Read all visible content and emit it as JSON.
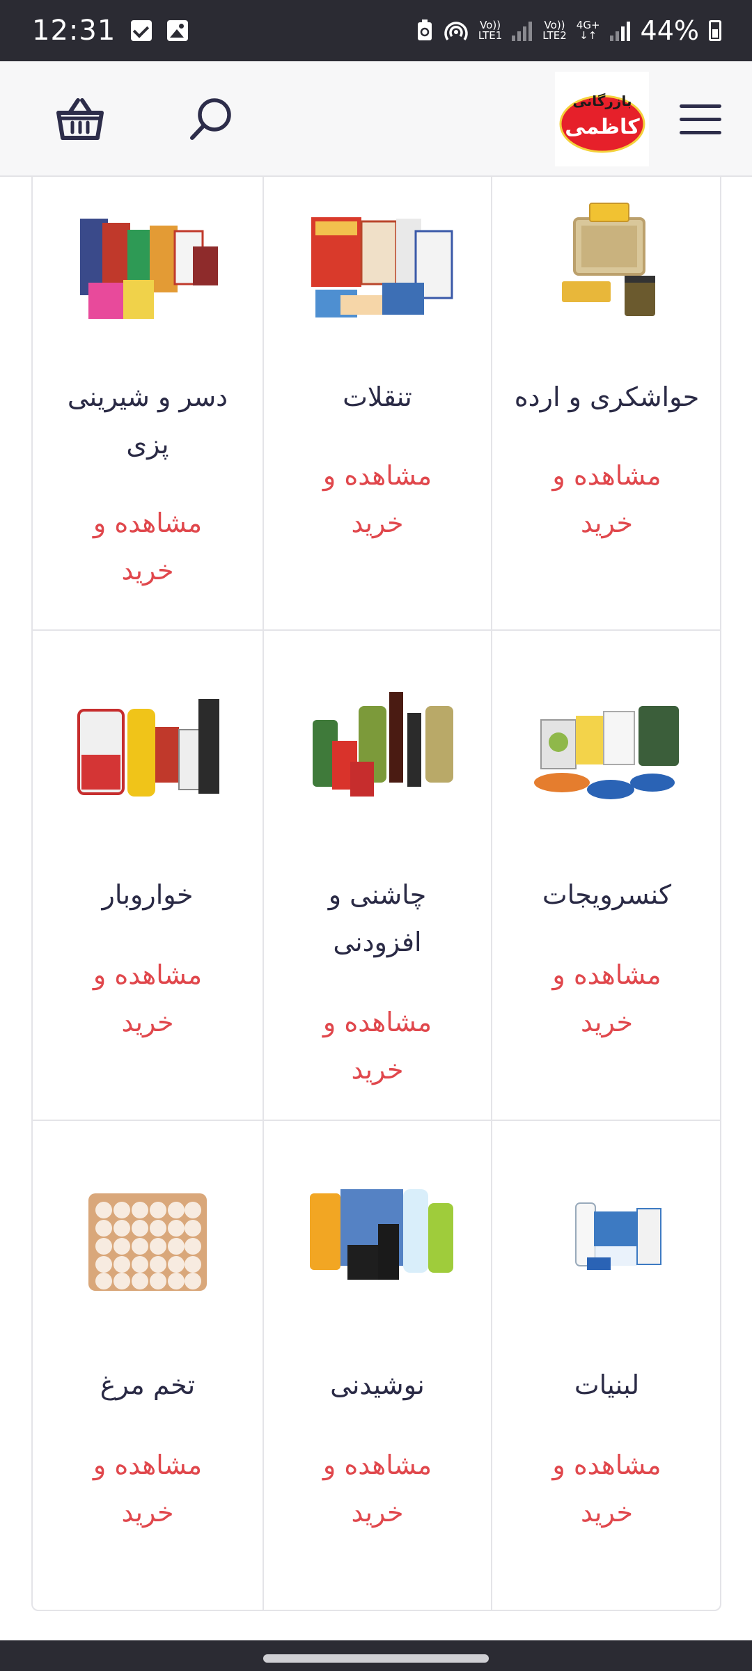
{
  "status_bar": {
    "time": "12:31",
    "sim1_line1": "Vo))",
    "sim1_line2": "LTE1",
    "sim2_line1": "Vo))",
    "sim2_line2": "LTE2",
    "network": "4G+",
    "battery": "44%"
  },
  "header": {
    "logo_line1": "بازرگانی",
    "logo_line2": "کاظمی",
    "colors": {
      "logo_red": "#e6202a",
      "logo_yellow": "#f4d23c",
      "icon": "#2d2d4a"
    }
  },
  "categories": [
    {
      "title": "حواشکری و ارده",
      "cta": "مشاهده و",
      "cta2": "خرید",
      "icon": "halva-icon"
    },
    {
      "title": "تنقلات",
      "cta": "مشاهده و",
      "cta2": "خرید",
      "icon": "snacks-icon"
    },
    {
      "title": "دسر و شیرینی",
      "title2": "پزی",
      "cta": "مشاهده و",
      "cta2": "خرید",
      "icon": "dessert-icon"
    },
    {
      "title": "کنسرویجات",
      "cta": "مشاهده و",
      "cta2": "خرید",
      "icon": "canned-food-icon"
    },
    {
      "title": "چاشنی و",
      "title2": "افزودنی",
      "cta": "مشاهده و",
      "cta2": "خرید",
      "icon": "condiments-icon"
    },
    {
      "title": "خواروبار",
      "cta": "مشاهده و",
      "cta2": "خرید",
      "icon": "groceries-icon"
    },
    {
      "title": "لبنیات",
      "cta": "مشاهده و",
      "cta2": "خرید",
      "icon": "dairy-icon"
    },
    {
      "title": "نوشیدنی",
      "cta": "مشاهده و",
      "cta2": "خرید",
      "icon": "drinks-icon"
    },
    {
      "title": "تخم مرغ",
      "cta": "مشاهده و",
      "cta2": "خرید",
      "icon": "eggs-icon"
    }
  ],
  "colors": {
    "cta": "#e0474c",
    "title": "#2a2a45",
    "border": "#e4e4e8"
  }
}
